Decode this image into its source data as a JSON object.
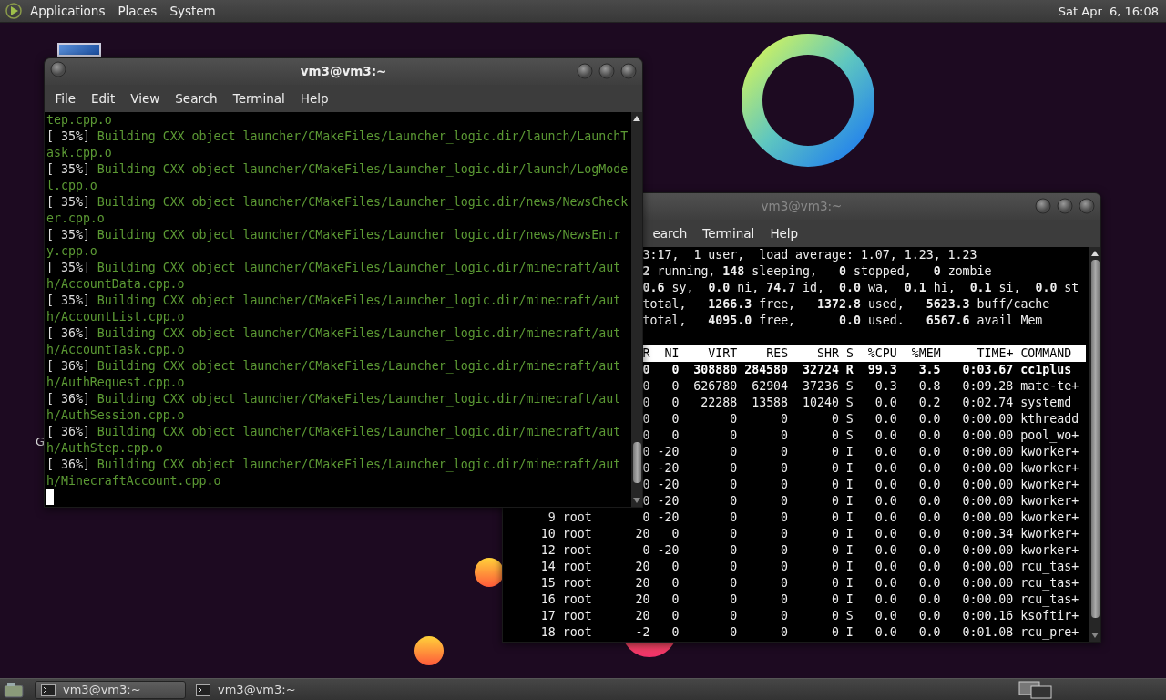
{
  "top_panel": {
    "menus": [
      {
        "label": "Applications"
      },
      {
        "label": "Places"
      },
      {
        "label": "System"
      }
    ],
    "clock": "Sat Apr  6, 16:08"
  },
  "desktop": {
    "icon_label": "G"
  },
  "build_terminal": {
    "title": "vm3@vm3:~",
    "active": true,
    "menus": [
      "File",
      "Edit",
      "View",
      "Search",
      "Terminal",
      "Help"
    ],
    "lines": [
      {
        "message": "tep.cpp.o"
      },
      {
        "progress": "[ 35%]",
        "message": "Building CXX object launcher/CMakeFiles/Launcher_logic.dir/launch/LaunchTask.cpp.o"
      },
      {
        "progress": "[ 35%]",
        "message": "Building CXX object launcher/CMakeFiles/Launcher_logic.dir/launch/LogModel.cpp.o"
      },
      {
        "progress": "[ 35%]",
        "message": "Building CXX object launcher/CMakeFiles/Launcher_logic.dir/news/NewsChecker.cpp.o"
      },
      {
        "progress": "[ 35%]",
        "message": "Building CXX object launcher/CMakeFiles/Launcher_logic.dir/news/NewsEntry.cpp.o"
      },
      {
        "progress": "[ 35%]",
        "message": "Building CXX object launcher/CMakeFiles/Launcher_logic.dir/minecraft/auth/AccountData.cpp.o"
      },
      {
        "progress": "[ 35%]",
        "message": "Building CXX object launcher/CMakeFiles/Launcher_logic.dir/minecraft/auth/AccountList.cpp.o"
      },
      {
        "progress": "[ 36%]",
        "message": "Building CXX object launcher/CMakeFiles/Launcher_logic.dir/minecraft/auth/AccountTask.cpp.o"
      },
      {
        "progress": "[ 36%]",
        "message": "Building CXX object launcher/CMakeFiles/Launcher_logic.dir/minecraft/auth/AuthRequest.cpp.o"
      },
      {
        "progress": "[ 36%]",
        "message": "Building CXX object launcher/CMakeFiles/Launcher_logic.dir/minecraft/auth/AuthSession.cpp.o"
      },
      {
        "progress": "[ 36%]",
        "message": "Building CXX object launcher/CMakeFiles/Launcher_logic.dir/minecraft/auth/AuthStep.cpp.o"
      },
      {
        "progress": "[ 36%]",
        "message": "Building CXX object launcher/CMakeFiles/Launcher_logic.dir/minecraft/auth/MinecraftAccount.cpp.o"
      }
    ]
  },
  "top_terminal": {
    "title": "vm3@vm3:~",
    "active": false,
    "menus": [
      "earch",
      "Terminal",
      "Help"
    ],
    "summary_lines": [
      "3:17,  1 user,  load average: 1.07, 1.23, 1.23",
      "**2** running, **148** sleeping,   **0** stopped,   **0** zombie",
      "**0.6** sy,  **0.0** ni, **74.7** id,  **0.0** wa,  **0.1** hi,  **0.1** si,  **0.0** st",
      "total,   **1266.3** free,   **1372.8** used,   **5623.3** buff/cache",
      "total,   **4095.0** free,      **0.0** used.   **6567.6** avail Mem"
    ],
    "header": "R  NI    VIRT    RES    SHR S  %CPU  %MEM     TIME+ COMMAND",
    "processes": [
      {
        "pr": "0",
        "ni": "0",
        "virt": "308880",
        "res": "284580",
        "shr": "32724",
        "s": "R",
        "cpu": "99.3",
        "mem": "3.5",
        "time": "0:03.67",
        "command": "cc1plus",
        "bold": true
      },
      {
        "pr": "0",
        "ni": "0",
        "virt": "626780",
        "res": "62904",
        "shr": "37236",
        "s": "S",
        "cpu": "0.3",
        "mem": "0.8",
        "time": "0:09.28",
        "command": "mate-te+",
        "bold": false
      },
      {
        "pr": "0",
        "ni": "0",
        "virt": "22288",
        "res": "13588",
        "shr": "10240",
        "s": "S",
        "cpu": "0.0",
        "mem": "0.2",
        "time": "0:02.74",
        "command": "systemd",
        "bold": false
      },
      {
        "pr": "0",
        "ni": "0",
        "virt": "0",
        "res": "0",
        "shr": "0",
        "s": "S",
        "cpu": "0.0",
        "mem": "0.0",
        "time": "0:00.00",
        "command": "kthreadd",
        "bold": false
      },
      {
        "pr": "0",
        "ni": "0",
        "virt": "0",
        "res": "0",
        "shr": "0",
        "s": "S",
        "cpu": "0.0",
        "mem": "0.0",
        "time": "0:00.00",
        "command": "pool_wo+",
        "bold": false
      },
      {
        "pr": "0",
        "ni": "-20",
        "virt": "0",
        "res": "0",
        "shr": "0",
        "s": "I",
        "cpu": "0.0",
        "mem": "0.0",
        "time": "0:00.00",
        "command": "kworker+",
        "bold": false
      },
      {
        "pr": "0",
        "ni": "-20",
        "virt": "0",
        "res": "0",
        "shr": "0",
        "s": "I",
        "cpu": "0.0",
        "mem": "0.0",
        "time": "0:00.00",
        "command": "kworker+",
        "bold": false
      },
      {
        "pr": "0",
        "ni": "-20",
        "virt": "0",
        "res": "0",
        "shr": "0",
        "s": "I",
        "cpu": "0.0",
        "mem": "0.0",
        "time": "0:00.00",
        "command": "kworker+",
        "bold": false
      },
      {
        "pr": "0",
        "ni": "-20",
        "virt": "0",
        "res": "0",
        "shr": "0",
        "s": "I",
        "cpu": "0.0",
        "mem": "0.0",
        "time": "0:00.00",
        "command": "kworker+",
        "bold": false
      },
      {
        "pid": "9",
        "user": "root",
        "pr": "0",
        "ni": "-20",
        "virt": "0",
        "res": "0",
        "shr": "0",
        "s": "I",
        "cpu": "0.0",
        "mem": "0.0",
        "time": "0:00.00",
        "command": "kworker+",
        "bold": false
      },
      {
        "pid": "10",
        "user": "root",
        "pr": "20",
        "ni": "0",
        "virt": "0",
        "res": "0",
        "shr": "0",
        "s": "I",
        "cpu": "0.0",
        "mem": "0.0",
        "time": "0:00.34",
        "command": "kworker+",
        "bold": false
      },
      {
        "pid": "12",
        "user": "root",
        "pr": "0",
        "ni": "-20",
        "virt": "0",
        "res": "0",
        "shr": "0",
        "s": "I",
        "cpu": "0.0",
        "mem": "0.0",
        "time": "0:00.00",
        "command": "kworker+",
        "bold": false
      },
      {
        "pid": "14",
        "user": "root",
        "pr": "20",
        "ni": "0",
        "virt": "0",
        "res": "0",
        "shr": "0",
        "s": "I",
        "cpu": "0.0",
        "mem": "0.0",
        "time": "0:00.00",
        "command": "rcu_tas+",
        "bold": false
      },
      {
        "pid": "15",
        "user": "root",
        "pr": "20",
        "ni": "0",
        "virt": "0",
        "res": "0",
        "shr": "0",
        "s": "I",
        "cpu": "0.0",
        "mem": "0.0",
        "time": "0:00.00",
        "command": "rcu_tas+",
        "bold": false
      },
      {
        "pid": "16",
        "user": "root",
        "pr": "20",
        "ni": "0",
        "virt": "0",
        "res": "0",
        "shr": "0",
        "s": "I",
        "cpu": "0.0",
        "mem": "0.0",
        "time": "0:00.00",
        "command": "rcu_tas+",
        "bold": false
      },
      {
        "pid": "17",
        "user": "root",
        "pr": "20",
        "ni": "0",
        "virt": "0",
        "res": "0",
        "shr": "0",
        "s": "S",
        "cpu": "0.0",
        "mem": "0.0",
        "time": "0:00.16",
        "command": "ksoftir+",
        "bold": false
      },
      {
        "pid": "18",
        "user": "root",
        "pr": "-2",
        "ni": "0",
        "virt": "0",
        "res": "0",
        "shr": "0",
        "s": "I",
        "cpu": "0.0",
        "mem": "0.0",
        "time": "0:01.08",
        "command": "rcu_pre+",
        "bold": false
      }
    ]
  },
  "taskbar": {
    "tasks": [
      {
        "label": "vm3@vm3:~",
        "selected": true
      },
      {
        "label": "vm3@vm3:~",
        "selected": false
      }
    ]
  }
}
